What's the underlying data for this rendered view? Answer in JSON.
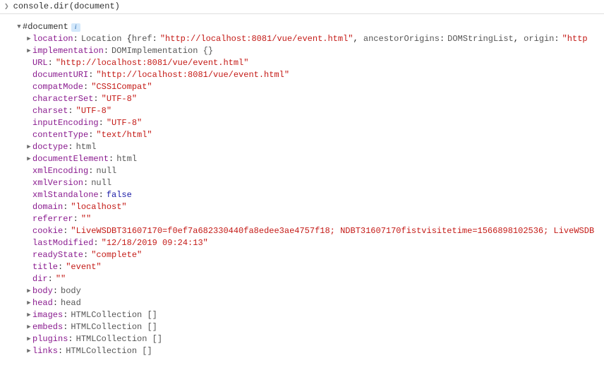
{
  "input": "console.dir(document)",
  "root_label": "#document",
  "props": {
    "location_key": "location",
    "location_type": "Location ",
    "location_href_k": "href",
    "location_href_v": "\"http://localhost:8081/vue/event.html\"",
    "location_anc_k": "ancestorOrigins",
    "location_anc_v": "DOMStringList",
    "location_origin_k": "origin",
    "location_origin_v": "\"http",
    "implementation_k": "implementation",
    "implementation_v": "DOMImplementation {}",
    "url_k": "URL",
    "url_v": "\"http://localhost:8081/vue/event.html\"",
    "docuri_k": "documentURI",
    "docuri_v": "\"http://localhost:8081/vue/event.html\"",
    "compat_k": "compatMode",
    "compat_v": "\"CSS1Compat\"",
    "charset_k": "characterSet",
    "charset_v": "\"UTF-8\"",
    "charset2_k": "charset",
    "charset2_v": "\"UTF-8\"",
    "inputenc_k": "inputEncoding",
    "inputenc_v": "\"UTF-8\"",
    "contenttype_k": "contentType",
    "contenttype_v": "\"text/html\"",
    "doctype_k": "doctype",
    "doctype_v": "html",
    "docel_k": "documentElement",
    "docel_v": "html",
    "xmlenc_k": "xmlEncoding",
    "xmlenc_v": "null",
    "xmlver_k": "xmlVersion",
    "xmlver_v": "null",
    "xmlsa_k": "xmlStandalone",
    "xmlsa_v": "false",
    "domain_k": "domain",
    "domain_v": "\"localhost\"",
    "referrer_k": "referrer",
    "referrer_v": "\"\"",
    "cookie_k": "cookie",
    "cookie_v": "\"LiveWSDBT31607170=f0ef7a682330440fa8edee3ae4757f18; NDBT31607170fistvisitetime=1566898102536; LiveWSDB",
    "lastmod_k": "lastModified",
    "lastmod_v": "\"12/18/2019 09:24:13\"",
    "ready_k": "readyState",
    "ready_v": "\"complete\"",
    "title_k": "title",
    "title_v": "\"event\"",
    "dir_k": "dir",
    "dir_v": "\"\"",
    "body_k": "body",
    "body_v": "body",
    "head_k": "head",
    "head_v": "head",
    "images_k": "images",
    "images_v": "HTMLCollection []",
    "embeds_k": "embeds",
    "embeds_v": "HTMLCollection []",
    "plugins_k": "plugins",
    "plugins_v": "HTMLCollection []",
    "links_k": "links",
    "links_v": "HTMLCollection []"
  }
}
